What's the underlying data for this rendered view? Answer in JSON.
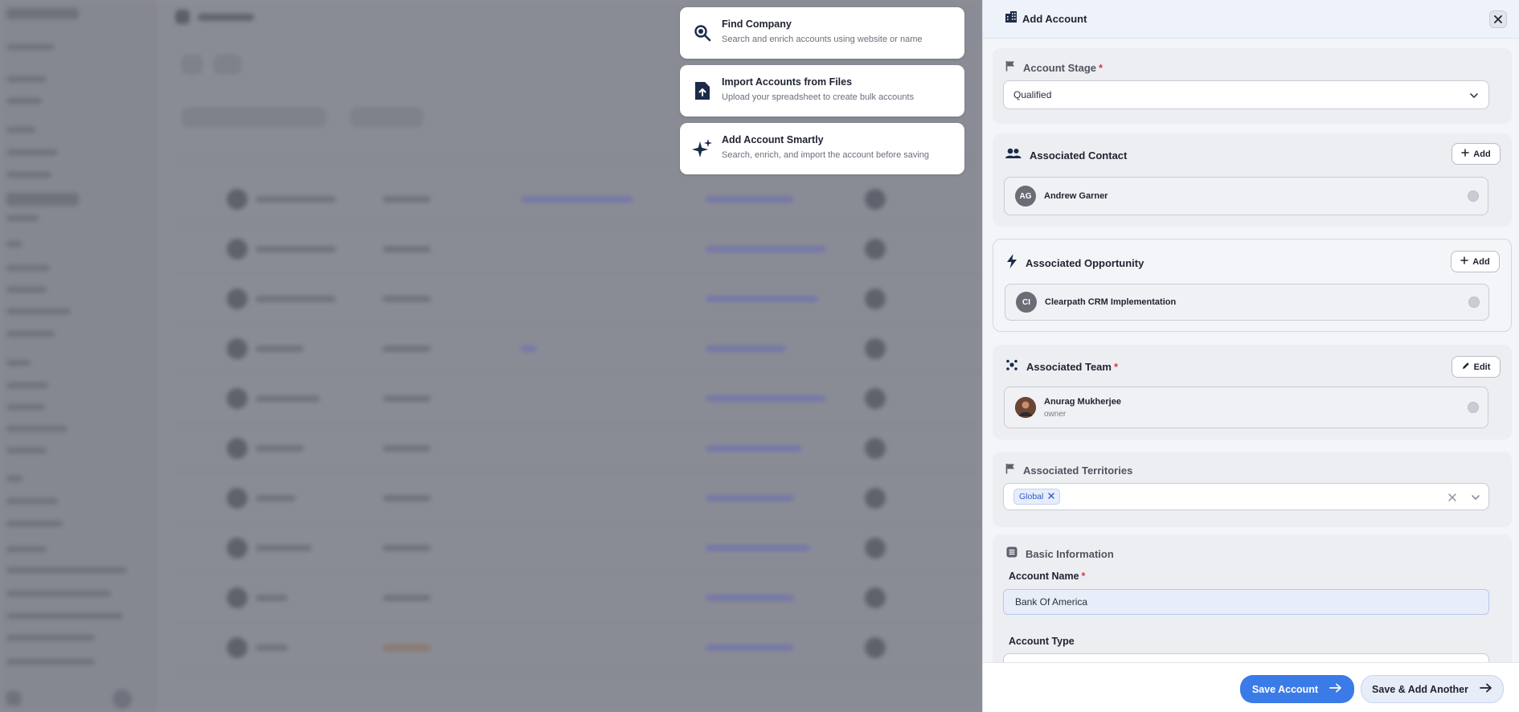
{
  "quick_options": [
    {
      "title": "Find Company",
      "subtitle": "Search and enrich accounts using website or name",
      "icon": "search-company-icon"
    },
    {
      "title": "Import Accounts from Files",
      "subtitle": "Upload your spreadsheet to create bulk accounts",
      "icon": "file-upload-icon"
    },
    {
      "title": "Add Account Smartly",
      "subtitle": "Search, enrich, and import the account before saving",
      "icon": "sparkle-icon"
    }
  ],
  "panel": {
    "title": "Add Account",
    "account_stage": {
      "label": "Account Stage",
      "value": "Qualified"
    },
    "associated_contact": {
      "label": "Associated Contact",
      "add_label": "Add",
      "initials": "AG",
      "name": "Andrew Garner"
    },
    "associated_opportunity": {
      "label": "Associated Opportunity",
      "add_label": "Add",
      "initials": "CI",
      "name": "Clearpath CRM Implementation"
    },
    "associated_team": {
      "label": "Associated Team",
      "edit_label": "Edit",
      "name": "Anurag Mukherjee",
      "role": "owner"
    },
    "associated_territories": {
      "label": "Associated Territories",
      "tags": [
        "Global"
      ]
    },
    "basic_information": {
      "label": "Basic Information",
      "account_name_label": "Account Name",
      "account_name_value": "Bank Of America",
      "account_type_label": "Account Type"
    },
    "footer": {
      "save_label": "Save Account",
      "save_add_label": "Save & Add Another"
    }
  },
  "colors": {
    "accent": "#3b7be8",
    "required": "#d93848",
    "tag": "#3059c9"
  }
}
